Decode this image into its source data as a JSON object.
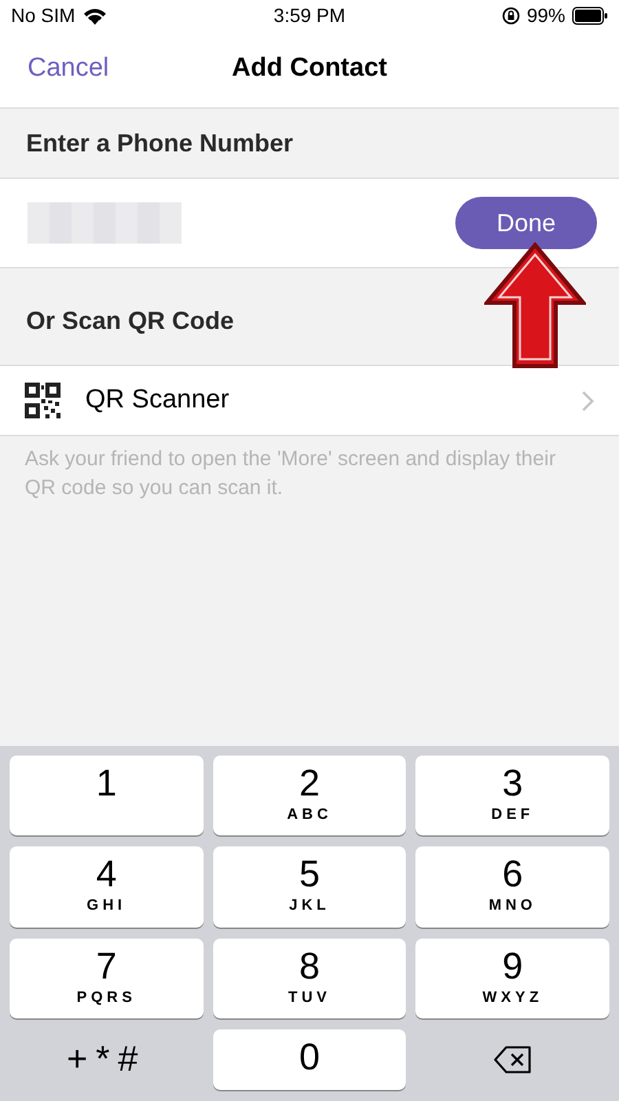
{
  "status_bar": {
    "carrier": "No SIM",
    "time": "3:59 PM",
    "battery": "99%"
  },
  "nav": {
    "cancel": "Cancel",
    "title": "Add Contact"
  },
  "phone_section": {
    "header": "Enter a Phone Number",
    "value_obscured": true,
    "done": "Done"
  },
  "qr_section": {
    "header": "Or Scan QR Code",
    "item": "QR Scanner",
    "note": "Ask your friend to open the 'More' screen and display their QR code so you can scan it."
  },
  "keypad": [
    {
      "kind": "digit",
      "digit": "1"
    },
    {
      "kind": "digit",
      "digit": "2",
      "letters": "ABC"
    },
    {
      "kind": "digit",
      "digit": "3",
      "letters": "DEF"
    },
    {
      "kind": "digit",
      "digit": "4",
      "letters": "GHI"
    },
    {
      "kind": "digit",
      "digit": "5",
      "letters": "JKL"
    },
    {
      "kind": "digit",
      "digit": "6",
      "letters": "MNO"
    },
    {
      "kind": "digit",
      "digit": "7",
      "letters": "PQRS"
    },
    {
      "kind": "digit",
      "digit": "8",
      "letters": "TUV"
    },
    {
      "kind": "digit",
      "digit": "9",
      "letters": "WXYZ"
    },
    {
      "kind": "symbols",
      "label": "+*#"
    },
    {
      "kind": "digit",
      "digit": "0"
    },
    {
      "kind": "delete"
    }
  ]
}
